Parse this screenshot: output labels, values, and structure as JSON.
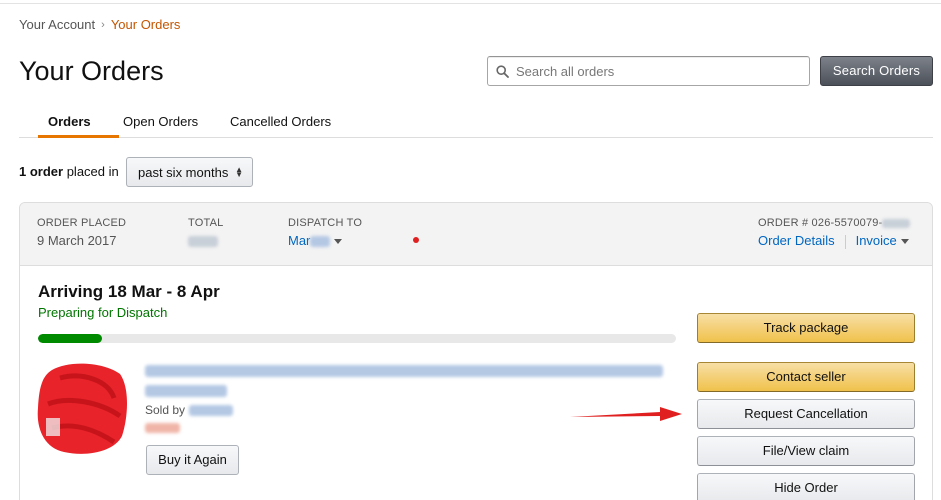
{
  "breadcrumb": {
    "account": "Your Account",
    "separator": "›",
    "current": "Your Orders"
  },
  "page": {
    "title": "Your Orders"
  },
  "search": {
    "placeholder": "Search all orders",
    "button_label": "Search Orders",
    "icon": "search-icon"
  },
  "tabs": [
    {
      "label": "Orders",
      "active": true
    },
    {
      "label": "Open Orders",
      "active": false
    },
    {
      "label": "Cancelled Orders",
      "active": false
    }
  ],
  "summary": {
    "count": "1 order",
    "text": "placed in",
    "period": "past six months"
  },
  "order": {
    "placed_label": "ORDER PLACED",
    "placed_value": "9 March 2017",
    "total_label": "TOTAL",
    "dispatch_label": "DISPATCH TO",
    "dispatch_value": "Mar",
    "order_number_label": "ORDER # 026-5570079-",
    "details_link": "Order Details",
    "invoice_link": "Invoice",
    "arriving": "Arriving 18 Mar - 8 Apr",
    "status": "Preparing for Dispatch",
    "progress": 0.1,
    "sold_by_label": "Sold by",
    "buy_again": "Buy it Again"
  },
  "actions": {
    "track": "Track package",
    "contact": "Contact seller",
    "cancel": "Request Cancellation",
    "claim": "File/View claim",
    "hide": "Hide Order"
  },
  "colors": {
    "accent": "#e77600",
    "link": "#0066c0",
    "status_green": "#007600",
    "primary_button": "#f0c14b",
    "annotation_red": "#e02020"
  }
}
